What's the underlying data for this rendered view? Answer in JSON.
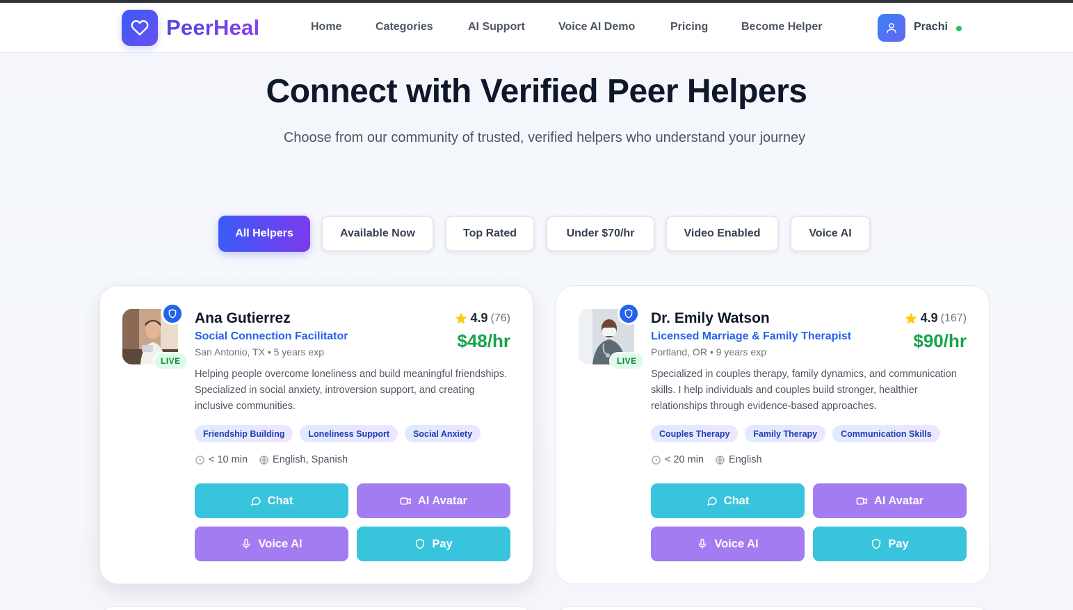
{
  "brand": {
    "name": "PeerHeal",
    "logo_icon": "heart-icon",
    "accent": "#4f46e5"
  },
  "nav": {
    "links": [
      "Home",
      "Categories",
      "AI Support",
      "Voice AI Demo",
      "Pricing",
      "Become Helper"
    ],
    "user": {
      "name": "Prachi",
      "avatar_icon": "user-icon",
      "status": "online",
      "status_color": "#22c55e"
    }
  },
  "hero": {
    "title": "Connect with Verified Peer Helpers",
    "subtitle": "Choose from our community of trusted, verified helpers who understand your journey"
  },
  "filters": {
    "items": [
      "All Helpers",
      "Available Now",
      "Top Rated",
      "Under $70/hr",
      "Video Enabled",
      "Voice AI"
    ],
    "active": "All Helpers"
  },
  "helpers": [
    {
      "name": "Ana Gutierrez",
      "role": "Social Connection Facilitator",
      "location": "San Antonio, TX",
      "experience": "5 years exp",
      "rating": "4.9",
      "reviews": "(76)",
      "price": "$48/hr",
      "live": "LIVE",
      "description": "Helping people overcome loneliness and build meaningful friendships. Specialized in social anxiety, introversion support, and creating inclusive communities.",
      "tags": [
        "Friendship Building",
        "Loneliness Support",
        "Social Anxiety"
      ],
      "response_time": "< 10 min",
      "languages": "English, Spanish",
      "buttons": {
        "chat": "Chat",
        "avatar": "AI Avatar",
        "voice": "Voice AI",
        "pay": "Pay"
      }
    },
    {
      "name": "Dr. Emily Watson",
      "role": "Licensed Marriage & Family Therapist",
      "location": "Portland, OR",
      "experience": "9 years exp",
      "rating": "4.9",
      "reviews": "(167)",
      "price": "$90/hr",
      "live": "LIVE",
      "description": "Specialized in couples therapy, family dynamics, and communication skills. I help individuals and couples build stronger, healthier relationships through evidence-based approaches.",
      "tags": [
        "Couples Therapy",
        "Family Therapy",
        "Communication Skills"
      ],
      "response_time": "< 20 min",
      "languages": "English",
      "buttons": {
        "chat": "Chat",
        "avatar": "AI Avatar",
        "voice": "Voice AI",
        "pay": "Pay"
      }
    }
  ],
  "colors": {
    "chat_button": "#38c4dd",
    "avatar_button": "#a27cf0",
    "price": "#16a34a",
    "verified": "#2563eb",
    "star": "#facc15"
  }
}
